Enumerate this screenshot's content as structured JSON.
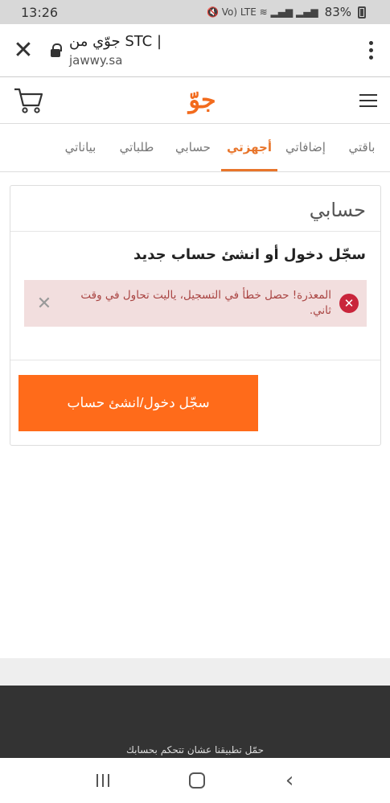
{
  "status_bar": {
    "time": "13:26",
    "network_icons": "🔇 Vo) LTE ≋ ▂▄▆ ▂▄▆",
    "battery": "83%"
  },
  "browser": {
    "close_glyph": "✕",
    "tab_title": "جوّي من STC |",
    "url": "jawwy.sa"
  },
  "header": {
    "logo_text": "جوّ"
  },
  "nav": {
    "tabs": [
      "باقتي",
      "إضافاتي",
      "أجهزتي",
      "حسابي",
      "طلباتي",
      "بياناتي"
    ],
    "active_index": 2
  },
  "card": {
    "title": "حسابي",
    "subtitle": "سجّل دخول أو انشئ حساب جديد",
    "error_text": "المعذرة! حصل خطأ في التسجيل، ياليت تحاول في وقت ثاني.",
    "error_close": "✕",
    "button_label": "سجّل دخول/انشئ حساب"
  },
  "footer": {
    "text": "حمّل تطبيقنا عشان تتحكم بحسابك"
  },
  "colors": {
    "accent": "#ff6b1a",
    "error_bg": "#f2dede",
    "error_text": "#a94442",
    "footer_bg": "#333333"
  }
}
